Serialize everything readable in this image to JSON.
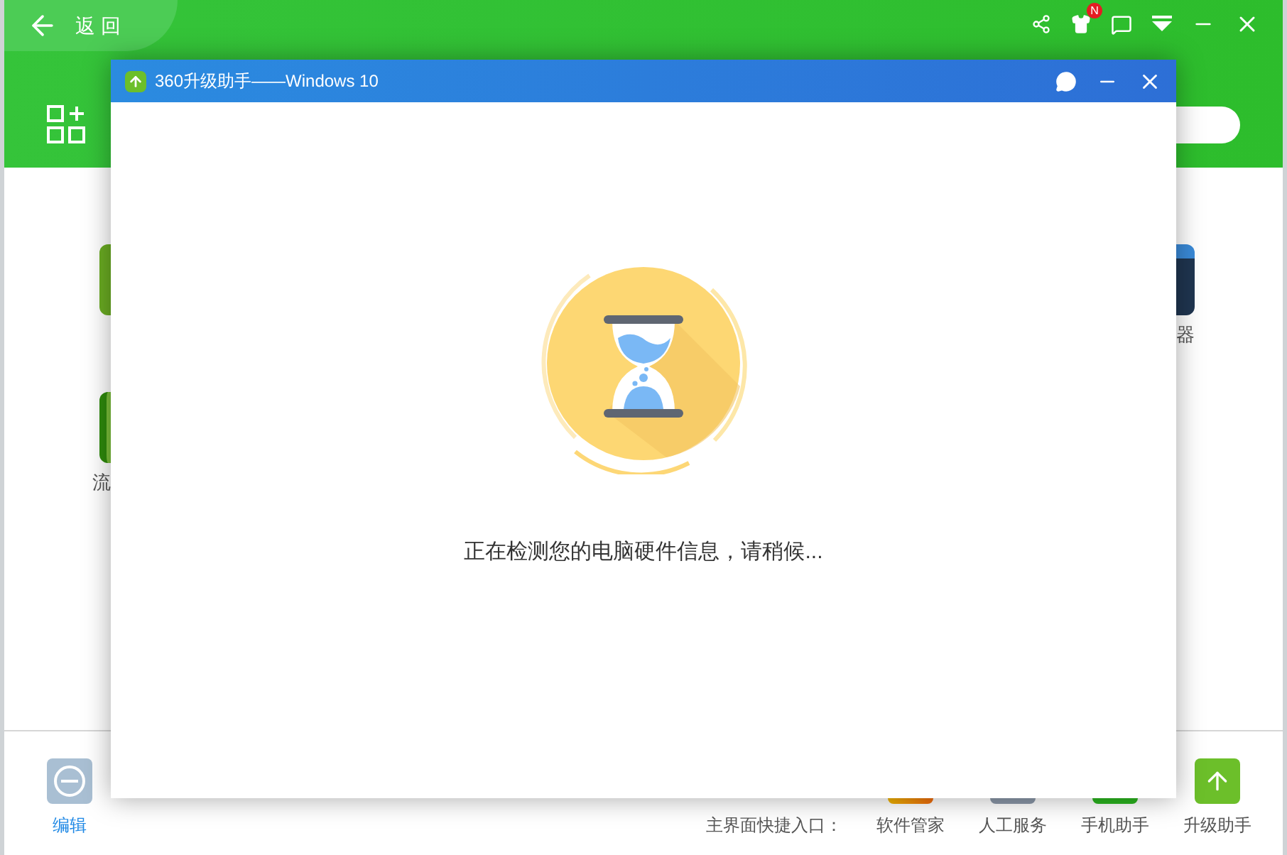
{
  "app": {
    "back_button": "返 回",
    "notification_badge": "N",
    "left_apps": [
      {
        "label": "流"
      }
    ],
    "right_apps": [
      {
        "label": "器"
      }
    ],
    "edit_button": "编辑",
    "shortcuts_label": "主界面快捷入口：",
    "shortcuts": [
      {
        "label": "软件管家"
      },
      {
        "label": "人工服务"
      },
      {
        "label": "手机助手"
      },
      {
        "label": "升级助手"
      }
    ]
  },
  "dialog": {
    "title": "360升级助手——Windows 10",
    "message": "正在检测您的电脑硬件信息，请稍候..."
  }
}
